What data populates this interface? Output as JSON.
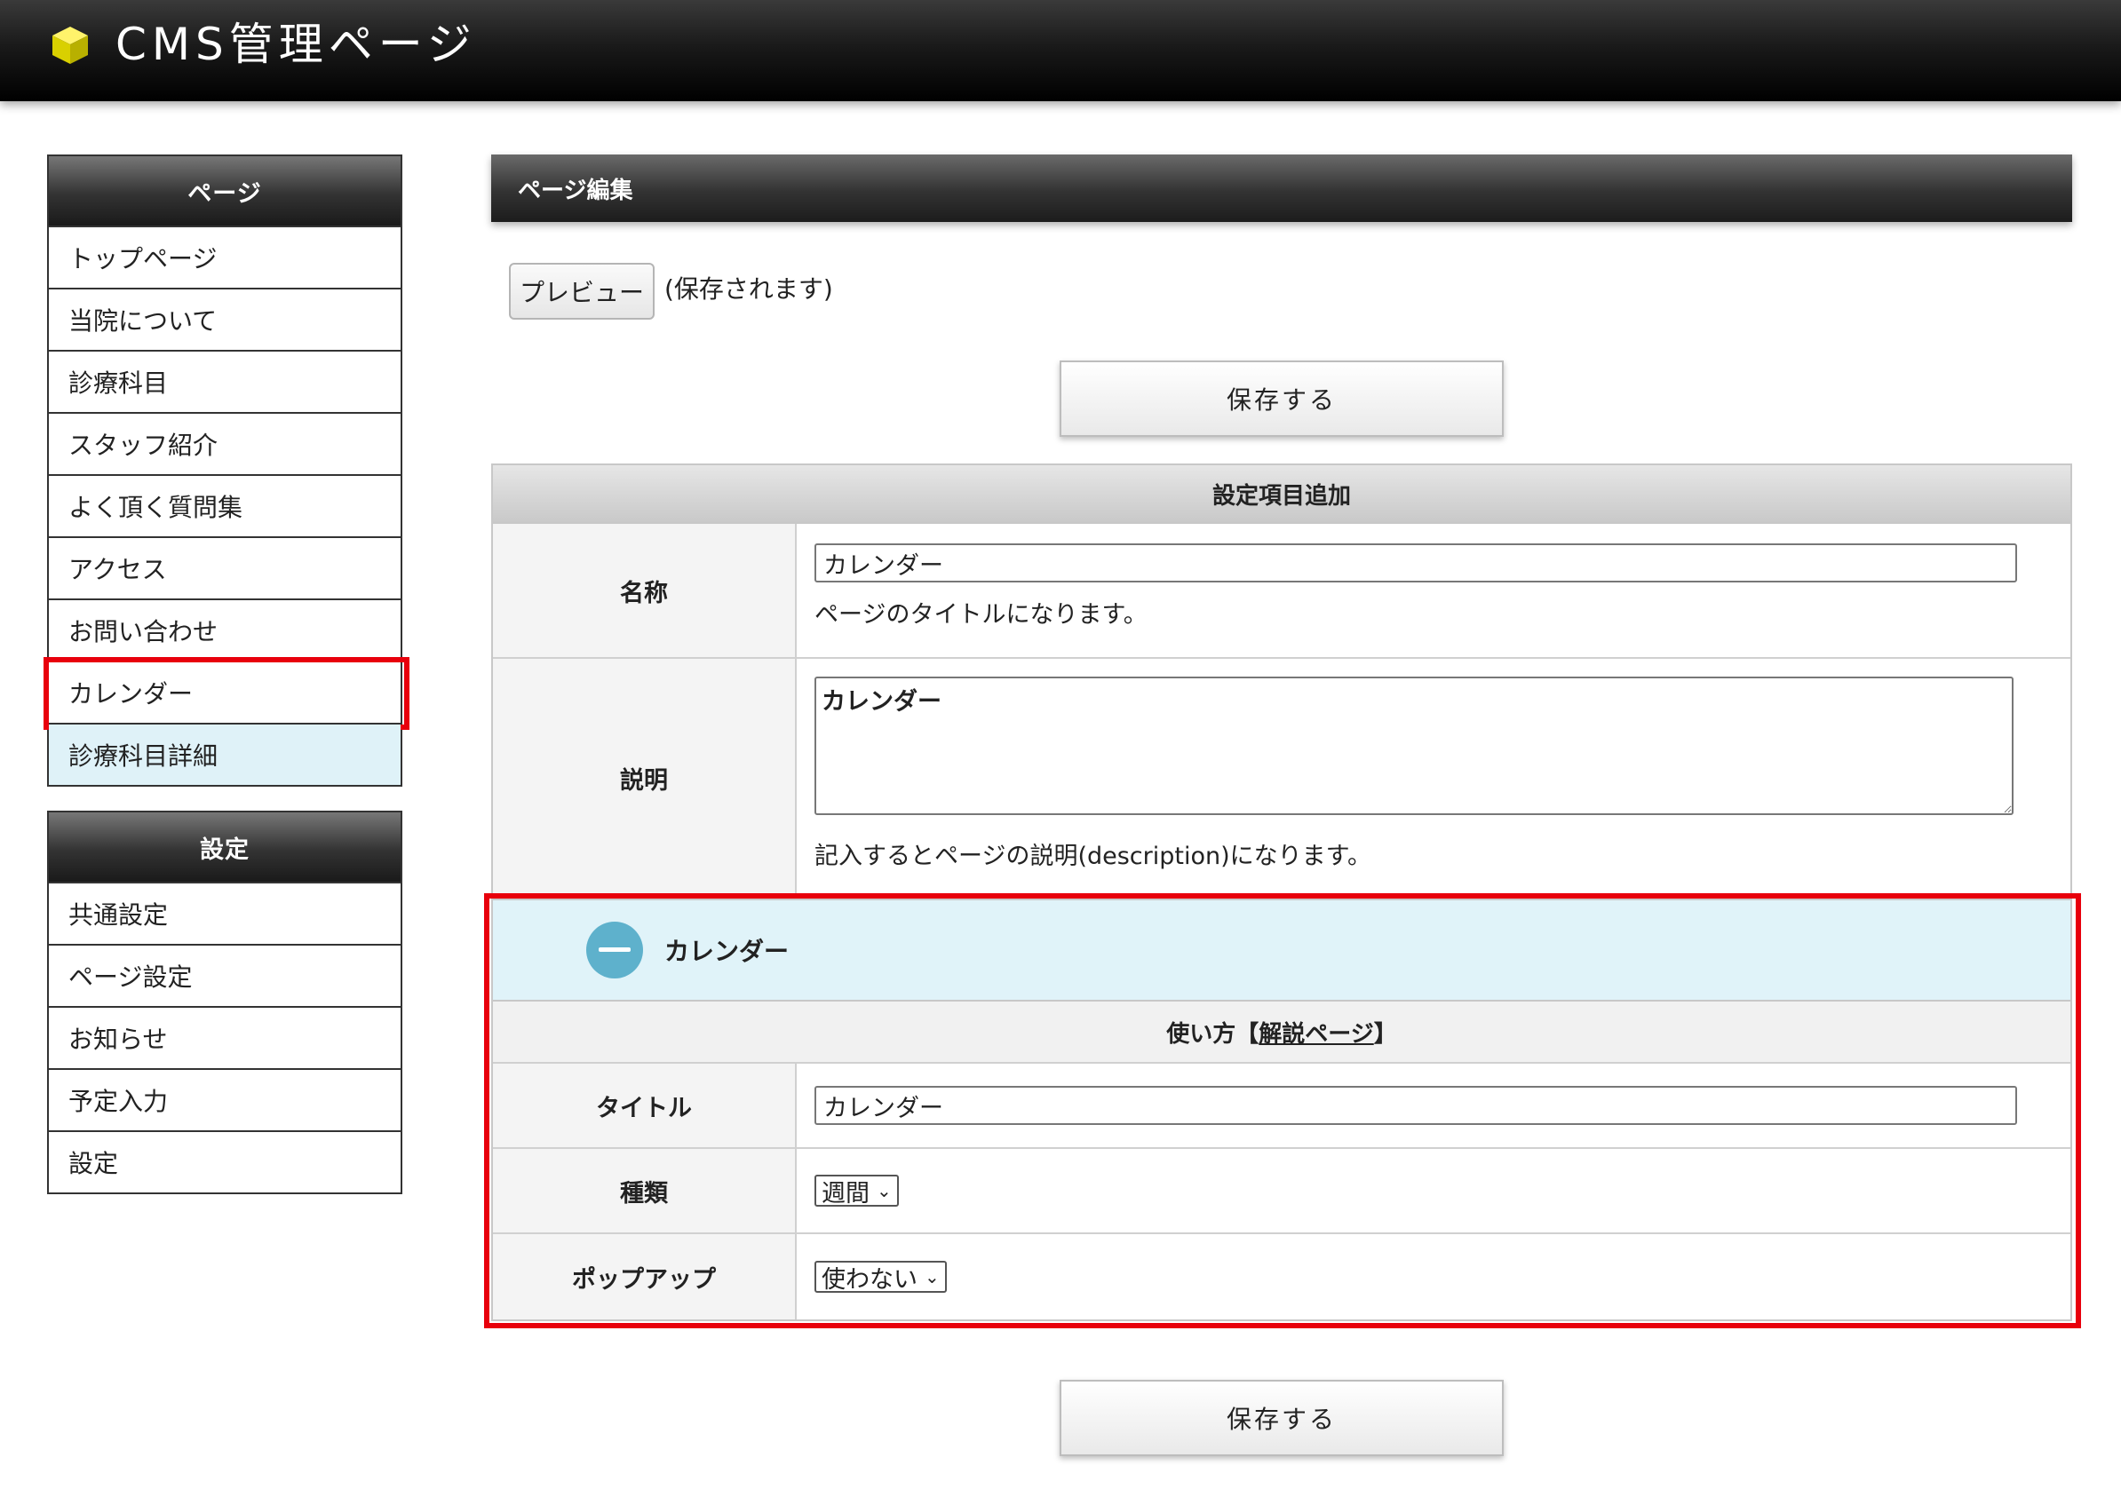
{
  "header": {
    "title": "CMS管理ページ",
    "logo_color": "#e8e200"
  },
  "sidebar": {
    "pages_heading": "ページ",
    "pages": [
      {
        "label": "トップページ"
      },
      {
        "label": "当院について"
      },
      {
        "label": "診療科目"
      },
      {
        "label": "スタッフ紹介"
      },
      {
        "label": "よく頂く質問集"
      },
      {
        "label": "アクセス"
      },
      {
        "label": "お問い合わせ"
      },
      {
        "label": "カレンダー"
      },
      {
        "label": "診療科目詳細"
      }
    ],
    "settings_heading": "設定",
    "settings": [
      {
        "label": "共通設定"
      },
      {
        "label": "ページ設定"
      },
      {
        "label": "お知らせ"
      },
      {
        "label": "予定入力"
      },
      {
        "label": "設定"
      }
    ]
  },
  "main": {
    "heading": "ページ編集",
    "preview_label": "プレビュー",
    "preview_note": "(保存されます)",
    "save_label": "保存する",
    "section_heading": "設定項目追加",
    "name": {
      "label": "名称",
      "value": "カレンダー",
      "hint": "ページのタイトルになります。"
    },
    "description": {
      "label": "説明",
      "value": "カレンダー",
      "hint": "記入するとページの説明(description)になります。"
    },
    "calendar": {
      "title": "カレンダー",
      "usage_prefix": "使い方【",
      "usage_link": "解説ページ",
      "usage_suffix": "】",
      "title_field": {
        "label": "タイトル",
        "value": "カレンダー"
      },
      "kind_field": {
        "label": "種類",
        "value": "週間"
      },
      "popup_field": {
        "label": "ポップアップ",
        "value": "使わない"
      }
    }
  },
  "colors": {
    "highlight": "#e8000c",
    "accent_bg": "#e0f3f9",
    "minus_icon": "#5eb1cc"
  }
}
